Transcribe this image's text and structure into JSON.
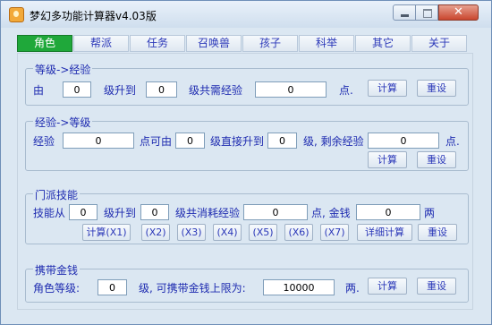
{
  "window": {
    "title": "梦幻多功能计算器v4.03版",
    "controls": {
      "minimize": "minimize",
      "maximize": "maximize",
      "close": "✕"
    }
  },
  "tabs": [
    "角色",
    "帮派",
    "任务",
    "召唤兽",
    "孩子",
    "科举",
    "其它",
    "关于"
  ],
  "active_tab": "角色",
  "level_to_exp": {
    "title": "等级->经验",
    "from_label": "由",
    "from_value": "0",
    "to_label": "级升到",
    "to_value": "0",
    "need_label": "级共需经验",
    "need_value": "0",
    "dot": "点.",
    "calc": "计算",
    "reset": "重设"
  },
  "exp_to_level": {
    "title": "经验->等级",
    "exp_label": "经验",
    "exp_value": "0",
    "from_label": "点可由",
    "from_value": "0",
    "direct_label": "级直接升到",
    "direct_value": "0",
    "remain_label": "级, 剩余经验",
    "remain_value": "0",
    "dot": "点.",
    "calc": "计算",
    "reset": "重设"
  },
  "sect_skill": {
    "title": "门派技能",
    "from_label": "技能从",
    "from_value": "0",
    "to_label": "级升到",
    "to_value": "0",
    "consume_label": "级共消耗经验",
    "consume_value": "0",
    "money_label": "点, 金钱",
    "money_value": "0",
    "unit": "两",
    "buttons": [
      "计算(X1)",
      "(X2)",
      "(X3)",
      "(X4)",
      "(X5)",
      "(X6)",
      "(X7)",
      "详细计算",
      "重设"
    ]
  },
  "carry_money": {
    "title": "携带金钱",
    "level_label": "角色等级:",
    "level_value": "0",
    "limit_label": "级, 可携带金钱上限为:",
    "limit_value": "10000",
    "unit": "两.",
    "calc": "计算",
    "reset": "重设"
  },
  "colors": {
    "accent_tab": "#1fa83a",
    "label_text": "#1e2bb0",
    "background": "#dbe7f2"
  }
}
